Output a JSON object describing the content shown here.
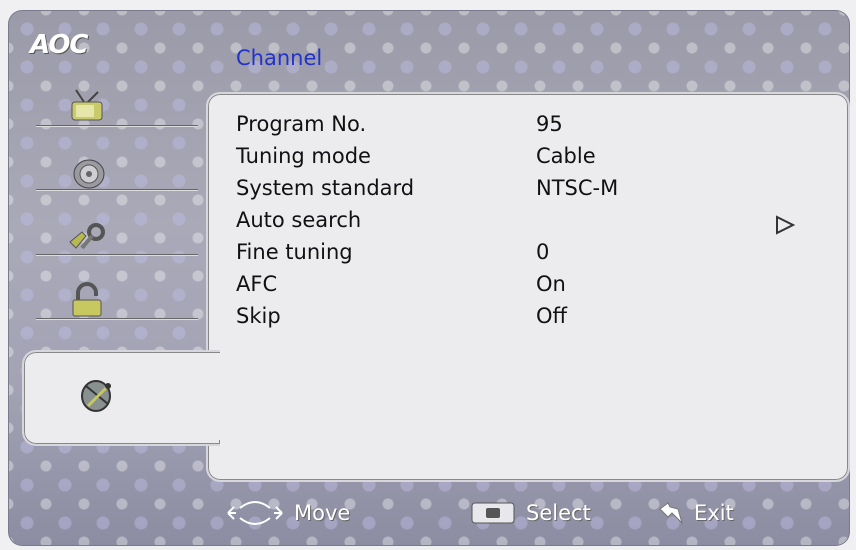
{
  "brand": {
    "logo": "AOC"
  },
  "header": {
    "title": "Channel"
  },
  "sidebar": {
    "items": [
      {
        "name": "picture",
        "icon": "tv-antenna-icon",
        "selected": false
      },
      {
        "name": "audio",
        "icon": "speaker-icon",
        "selected": false
      },
      {
        "name": "setup",
        "icon": "tools-icon",
        "selected": false
      },
      {
        "name": "lock",
        "icon": "lock-icon",
        "selected": false
      },
      {
        "name": "channel",
        "icon": "satellite-dish-icon",
        "selected": true
      }
    ]
  },
  "channel_menu": {
    "rows": [
      {
        "label": "Program No.",
        "value": "95"
      },
      {
        "label": "Tuning mode",
        "value": "Cable"
      },
      {
        "label": "System standard",
        "value": "NTSC-M"
      },
      {
        "label": "Auto search",
        "value": "",
        "has_arrow": true
      },
      {
        "label": "Fine tuning",
        "value": "0"
      },
      {
        "label": "AFC",
        "value": "On"
      },
      {
        "label": "Skip",
        "value": "Off"
      }
    ]
  },
  "footer": {
    "move_label": "Move",
    "select_label": "Select",
    "exit_label": "Exit"
  },
  "colors": {
    "title": "#2233cc",
    "panel": "#ececee",
    "osd_bg": "#a3a3b5"
  }
}
